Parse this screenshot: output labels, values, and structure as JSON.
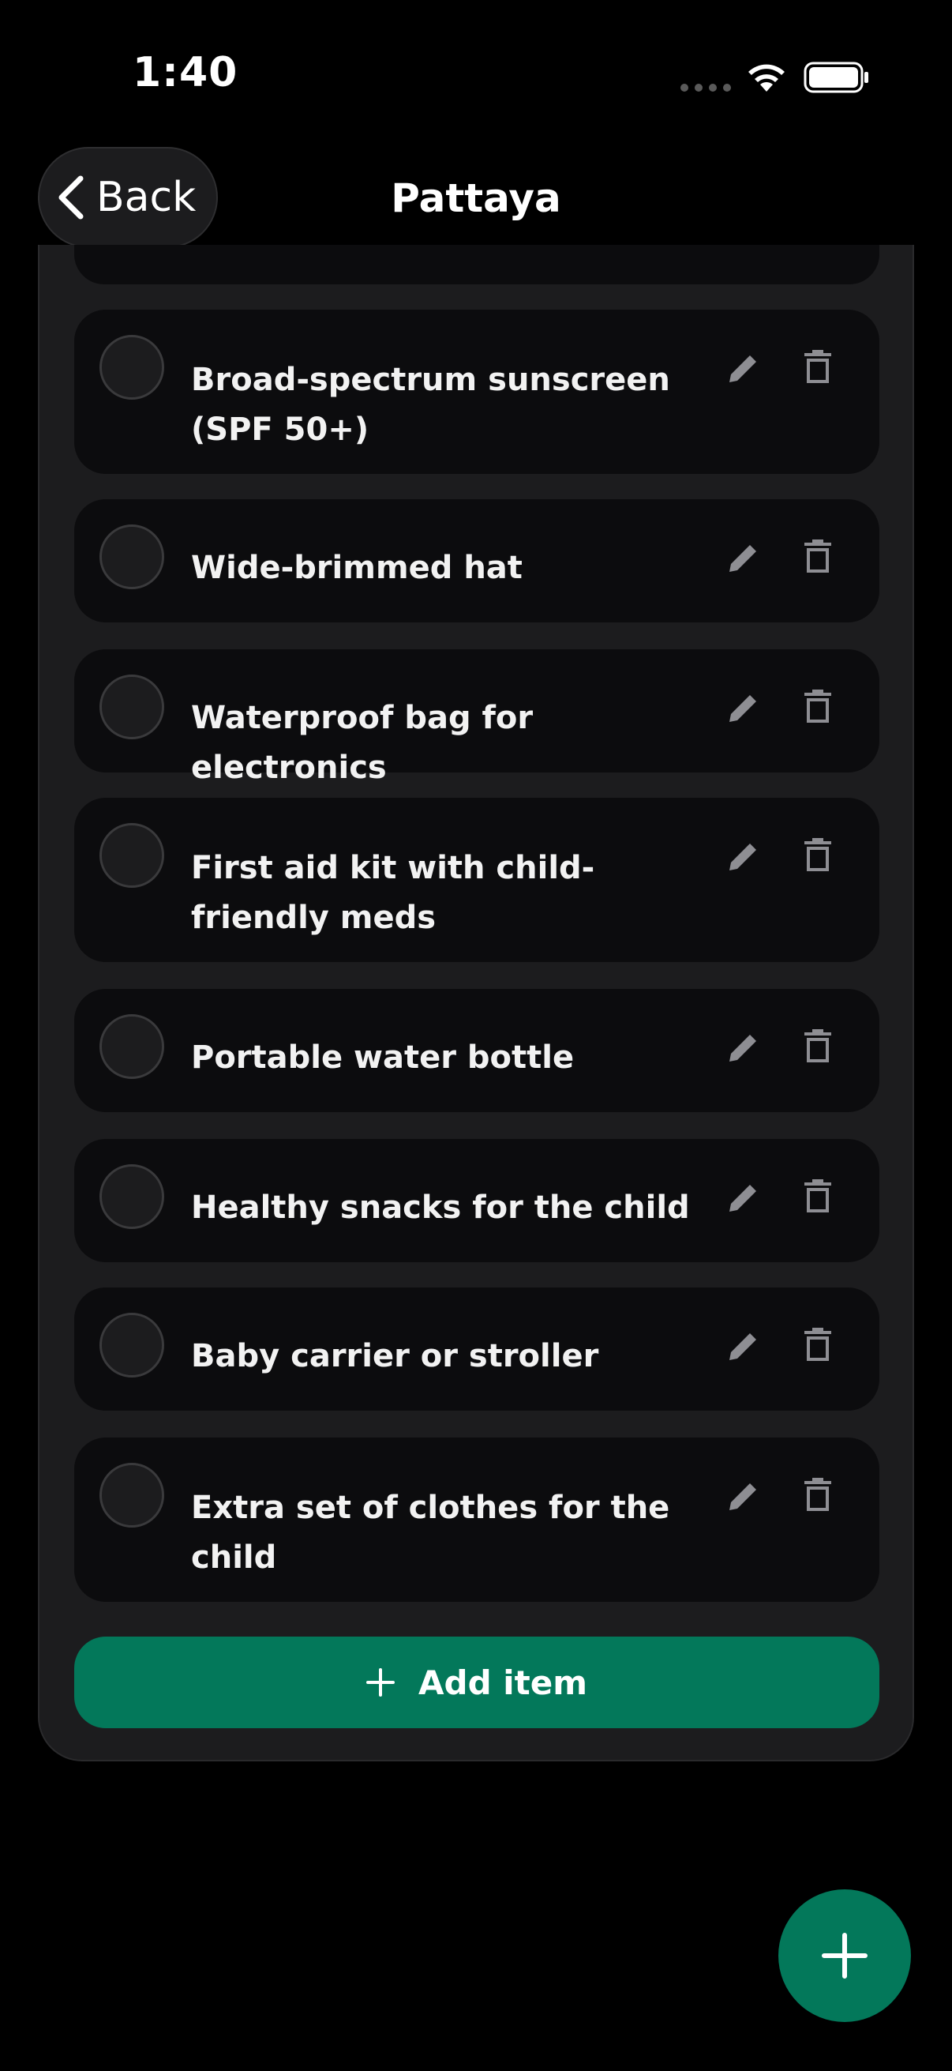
{
  "status_bar": {
    "time": "1:40"
  },
  "header": {
    "back_label": "Back",
    "title": "Pattaya"
  },
  "items": [
    {
      "label": "Broad-spectrum sunscreen (SPF 50+)",
      "checked": false
    },
    {
      "label": "Wide-brimmed hat",
      "checked": false
    },
    {
      "label": "Waterproof bag for electronics",
      "checked": false
    },
    {
      "label": "First aid kit with child-friendly meds",
      "checked": false
    },
    {
      "label": "Portable water bottle",
      "checked": false
    },
    {
      "label": "Healthy snacks for the child",
      "checked": false
    },
    {
      "label": "Baby carrier or stroller",
      "checked": false
    },
    {
      "label": "Extra set of clothes for the child",
      "checked": false
    }
  ],
  "add_item": {
    "label": "Add item"
  },
  "icons": {
    "back": "chevron-left-icon",
    "edit": "pencil-icon",
    "delete": "trash-icon",
    "add": "plus-icon",
    "wifi": "wifi-icon",
    "battery": "battery-icon"
  },
  "colors": {
    "accent": "#03785a",
    "background": "#000000",
    "card": "#1c1c1e",
    "item": "#0c0c0e"
  }
}
